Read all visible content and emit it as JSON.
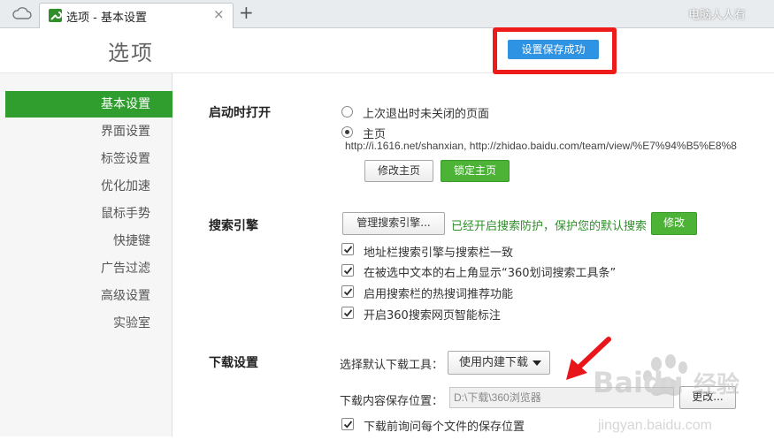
{
  "tab": {
    "title": "选项 - 基本设置",
    "close": "×",
    "new_tab": "+"
  },
  "watermark_top": "电脑人人有",
  "page_title": "选项",
  "toast": "设置保存成功",
  "sidebar": {
    "items": [
      {
        "label": "基本设置",
        "active": true
      },
      {
        "label": "界面设置"
      },
      {
        "label": "标签设置"
      },
      {
        "label": "优化加速"
      },
      {
        "label": "鼠标手势"
      },
      {
        "label": "快捷键"
      },
      {
        "label": "广告过滤"
      },
      {
        "label": "高级设置"
      },
      {
        "label": "实验室"
      }
    ]
  },
  "startup": {
    "title": "启动时打开",
    "option_last": "上次退出时未关闭的页面",
    "option_home": "主页",
    "home_url": "http://i.1616.net/shanxian, http://zhidao.baidu.com/team/view/%E7%94%B5%E8%8",
    "modify_home": "修改主页",
    "lock_home": "锁定主页"
  },
  "search": {
    "title": "搜索引擎",
    "manage": "管理搜索引擎...",
    "protect_text": "已经开启搜索防护，保护您的默认搜索",
    "modify": "修改",
    "checks": [
      "地址栏搜索引擎与搜索栏一致",
      "在被选中文本的右上角显示“360划词搜索工具条”",
      "启用搜索栏的热搜词推荐功能",
      "开启360搜索网页智能标注"
    ]
  },
  "download": {
    "title": "下载设置",
    "tool_label": "选择默认下载工具：",
    "tool_value": "使用内建下载",
    "path_label": "下载内容保存位置：",
    "path_value": "D:\\下载\\360浏览器",
    "change": "更改...",
    "ask_check": "下载前询问每个文件的保存位置"
  },
  "watermark": {
    "brand": "Baidu",
    "sub": "经验",
    "url": "jingyan.baidu.com"
  },
  "colors": {
    "accent_green": "#2f9e2e",
    "button_green": "#4cb337",
    "toast_blue": "#2e93e3",
    "highlight_red": "#ee1b1b"
  }
}
